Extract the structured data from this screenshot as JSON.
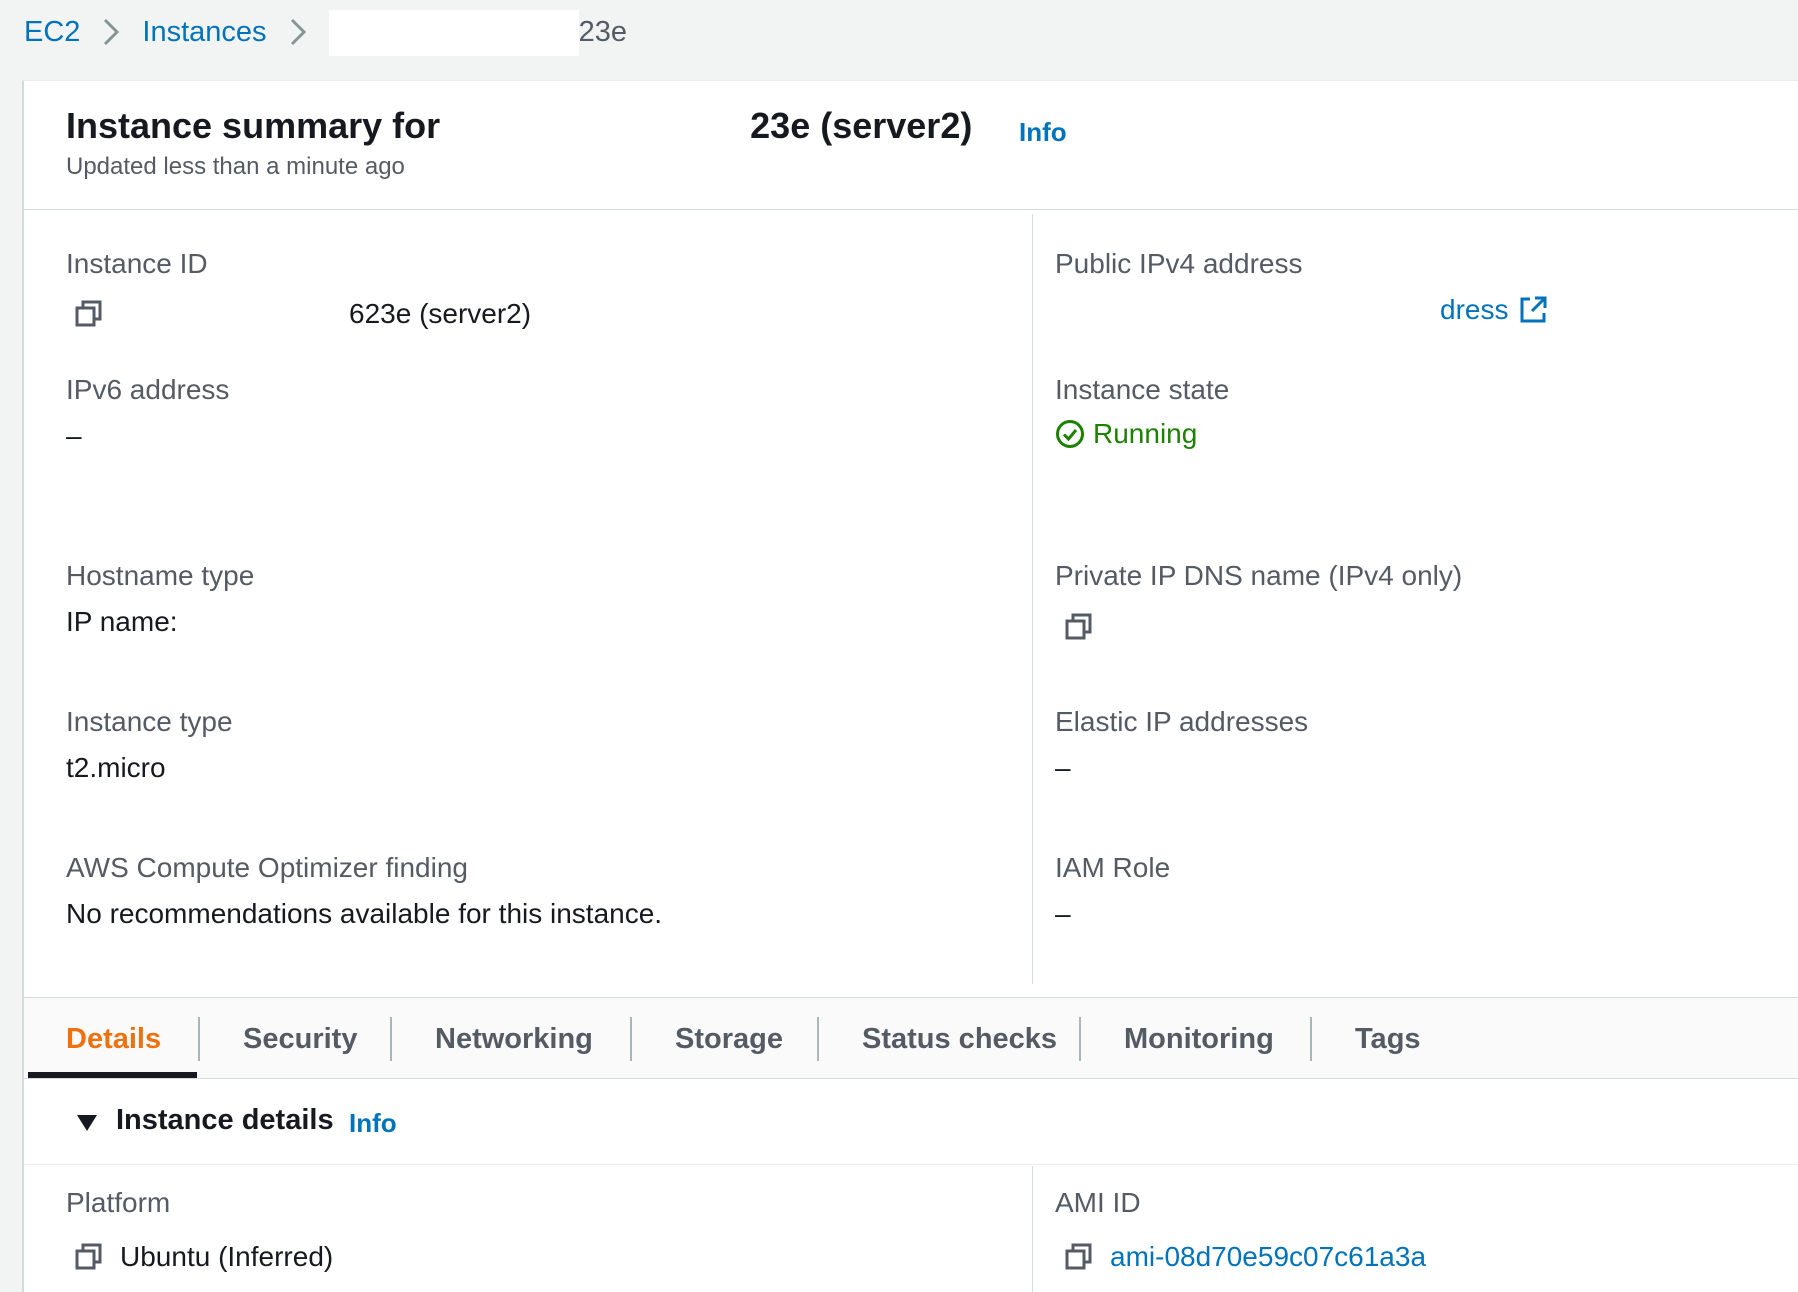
{
  "breadcrumb": {
    "items": [
      "EC2",
      "Instances"
    ],
    "current": "23e"
  },
  "summary": {
    "title_prefix": "Instance summary for",
    "title_suffix": "23e (server2)",
    "info": "Info",
    "updated": "Updated less than a minute ago"
  },
  "fields": {
    "instance_id": {
      "label": "Instance ID",
      "value": "623e (server2)"
    },
    "public_ipv4": {
      "label": "Public IPv4 address",
      "value": "dress"
    },
    "ipv6": {
      "label": "IPv6 address",
      "value": "–"
    },
    "instance_state": {
      "label": "Instance state",
      "value": "Running"
    },
    "hostname_type": {
      "label": "Hostname type",
      "value": "IP name:"
    },
    "private_dns": {
      "label": "Private IP DNS name (IPv4 only)"
    },
    "instance_type": {
      "label": "Instance type",
      "value": "t2.micro"
    },
    "elastic_ip": {
      "label": "Elastic IP addresses",
      "value": "–"
    },
    "optimizer": {
      "label": "AWS Compute Optimizer finding",
      "value": "No recommendations available for this instance."
    },
    "iam_role": {
      "label": "IAM Role",
      "value": "–"
    }
  },
  "tabs": [
    "Details",
    "Security",
    "Networking",
    "Storage",
    "Status checks",
    "Monitoring",
    "Tags"
  ],
  "active_tab": "Details",
  "details": {
    "title": "Instance details",
    "info": "Info",
    "platform": {
      "label": "Platform",
      "value": "Ubuntu (Inferred)"
    },
    "ami_id": {
      "label": "AMI ID",
      "value": "ami-08d70e59c07c61a3a"
    }
  },
  "colors": {
    "link": "#0073bb",
    "active_tab": "#ec7211",
    "running": "#1d8102",
    "label": "#545b64",
    "text": "#16191f"
  },
  "icons": {
    "copy": "copy-icon",
    "external": "external-link-icon",
    "status": "check-circle-icon",
    "chevron": "chevron-right-icon",
    "caret": "caret-down-icon"
  }
}
